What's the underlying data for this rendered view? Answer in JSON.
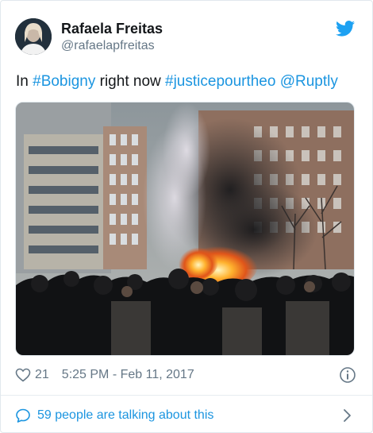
{
  "author": {
    "display_name": "Rafaela Freitas",
    "handle": "@rafaelapfreitas"
  },
  "tweet": {
    "prefix": "In ",
    "hashtag1": "#Bobigny",
    "middle": " right now ",
    "hashtag2": "#justicepourtheo",
    "space": " ",
    "mention": "@Ruptly"
  },
  "meta": {
    "like_count": "21",
    "timestamp": "5:25 PM - Feb 11, 2017"
  },
  "footer": {
    "talking_text": "59 people are talking about this"
  },
  "icons": {
    "brand": "twitter-bird-icon",
    "like": "heart-icon",
    "info": "info-icon",
    "reply": "reply-bubble-icon",
    "chevron": "chevron-right-icon"
  },
  "colors": {
    "link": "#1b95e0",
    "secondary": "#657786",
    "text": "#14171a",
    "brand": "#1da1f2"
  }
}
